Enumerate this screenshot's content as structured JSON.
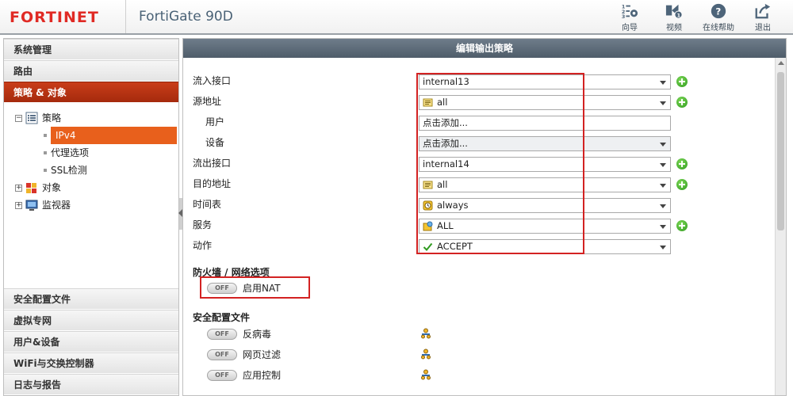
{
  "header": {
    "logo": "FORTINET",
    "product": "FortiGate 90D",
    "tools": [
      {
        "icon": "wizard-icon",
        "label": "向导"
      },
      {
        "icon": "video-icon",
        "label": "视频"
      },
      {
        "icon": "help-icon",
        "label": "在线帮助"
      },
      {
        "icon": "logout-icon",
        "label": "退出"
      }
    ]
  },
  "sidebar": {
    "top_items": [
      "系统管理",
      "路由",
      "策略 & 对象"
    ],
    "tree": {
      "policy": "策略",
      "ipv4": "IPv4",
      "proxy": "代理选项",
      "ssl": "SSL检测",
      "objects": "对象",
      "monitor": "监视器"
    },
    "bottom_items": [
      "安全配置文件",
      "虚拟专网",
      "用户&设备",
      "WiFi与交换控制器",
      "日志与报告"
    ]
  },
  "main": {
    "title": "编辑输出策略",
    "fields": {
      "incoming_label": "流入接口",
      "incoming_value": "internal13",
      "source_label": "源地址",
      "source_value": "all",
      "user_label": "用户",
      "user_value": "点击添加...",
      "device_label": "设备",
      "device_value": "点击添加...",
      "outgoing_label": "流出接口",
      "outgoing_value": "internal14",
      "dest_label": "目的地址",
      "dest_value": "all",
      "schedule_label": "时间表",
      "schedule_value": "always",
      "service_label": "服务",
      "service_value": "ALL",
      "action_label": "动作",
      "action_value": "ACCEPT"
    },
    "firewall_section": "防火墙 / 网络选项",
    "nat_toggle": "OFF",
    "nat_label": "启用NAT",
    "security_section": "安全配置文件",
    "profiles": [
      {
        "toggle": "OFF",
        "label": "反病毒"
      },
      {
        "toggle": "OFF",
        "label": "网页过滤"
      },
      {
        "toggle": "OFF",
        "label": "应用控制"
      }
    ]
  },
  "colors": {
    "brand_red": "#e02a24",
    "active_nav": "#b5310f",
    "selected_tree": "#e8601c",
    "title_bar": "#5c6a77",
    "highlight_box": "#d32222",
    "add_green": "#2f9a1f"
  }
}
